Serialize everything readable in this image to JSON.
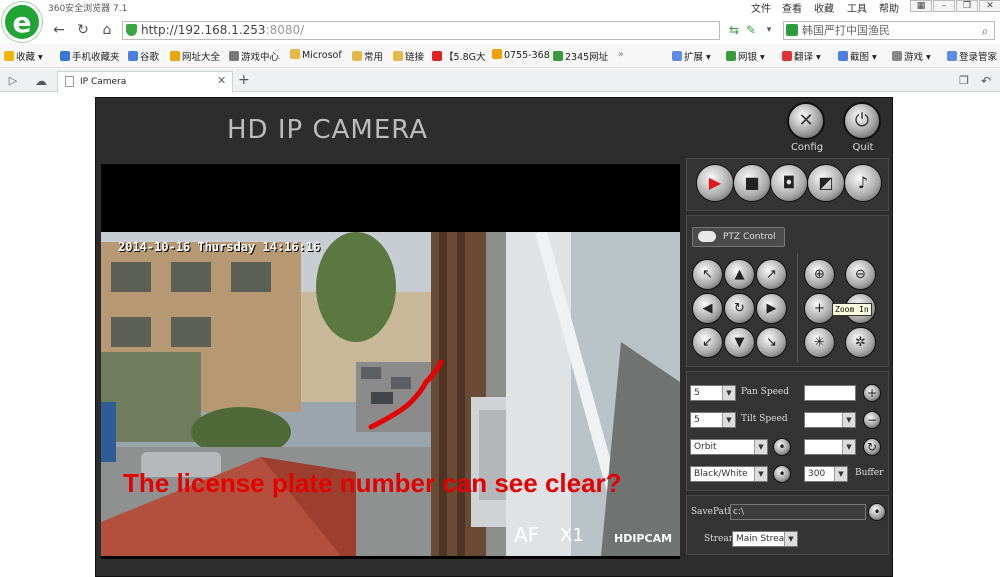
{
  "browser": {
    "app_title": "360安全浏览器 7.1",
    "menu": [
      "文件",
      "查看",
      "收藏",
      "工具",
      "帮助"
    ],
    "url_host": "http://192.168.1.253",
    "url_port": ":8080/",
    "search_text": "韩国严打中国渔民",
    "bookmarks": [
      "收藏",
      "手机收藏夹",
      "谷歌",
      "网址大全",
      "游戏中心",
      "Microsof",
      "常用",
      "链接",
      "【5.8G大",
      "0755-368",
      "2345网址"
    ],
    "right_tools": [
      "扩展",
      "网银",
      "翻译",
      "截图",
      "游戏",
      "登录管家"
    ],
    "tab_title": "IP Camera",
    "new_tab": "+"
  },
  "camera": {
    "title": "HD IP CAMERA",
    "config_label": "Config",
    "quit_label": "Quit",
    "timestamp": "2014-10-16 Thursday 14:16:16",
    "caption": "The license plate number can see clear?",
    "overlay_af": "AF",
    "overlay_x": "X1",
    "watermark": "HDIPCAM",
    "ptz_control": "PTZ Control",
    "tooltip": "Zoom In",
    "pan_speed_value": "5",
    "pan_speed_label": "Pan Speed",
    "tilt_speed_value": "5",
    "tilt_speed_label": "Tilt Speed",
    "orbit_value": "Orbit",
    "color_value": "Black/White",
    "buffer_value": "300",
    "buffer_label": "Buffer",
    "savepath_label": "SavePath",
    "savepath_value": "c:\\",
    "stream_label": "Stream",
    "stream_value": "Main Strea"
  },
  "colors": {
    "caption_red": "#e40000",
    "record_red": "#e0191a",
    "panel_bg": "#2d2d2d"
  }
}
